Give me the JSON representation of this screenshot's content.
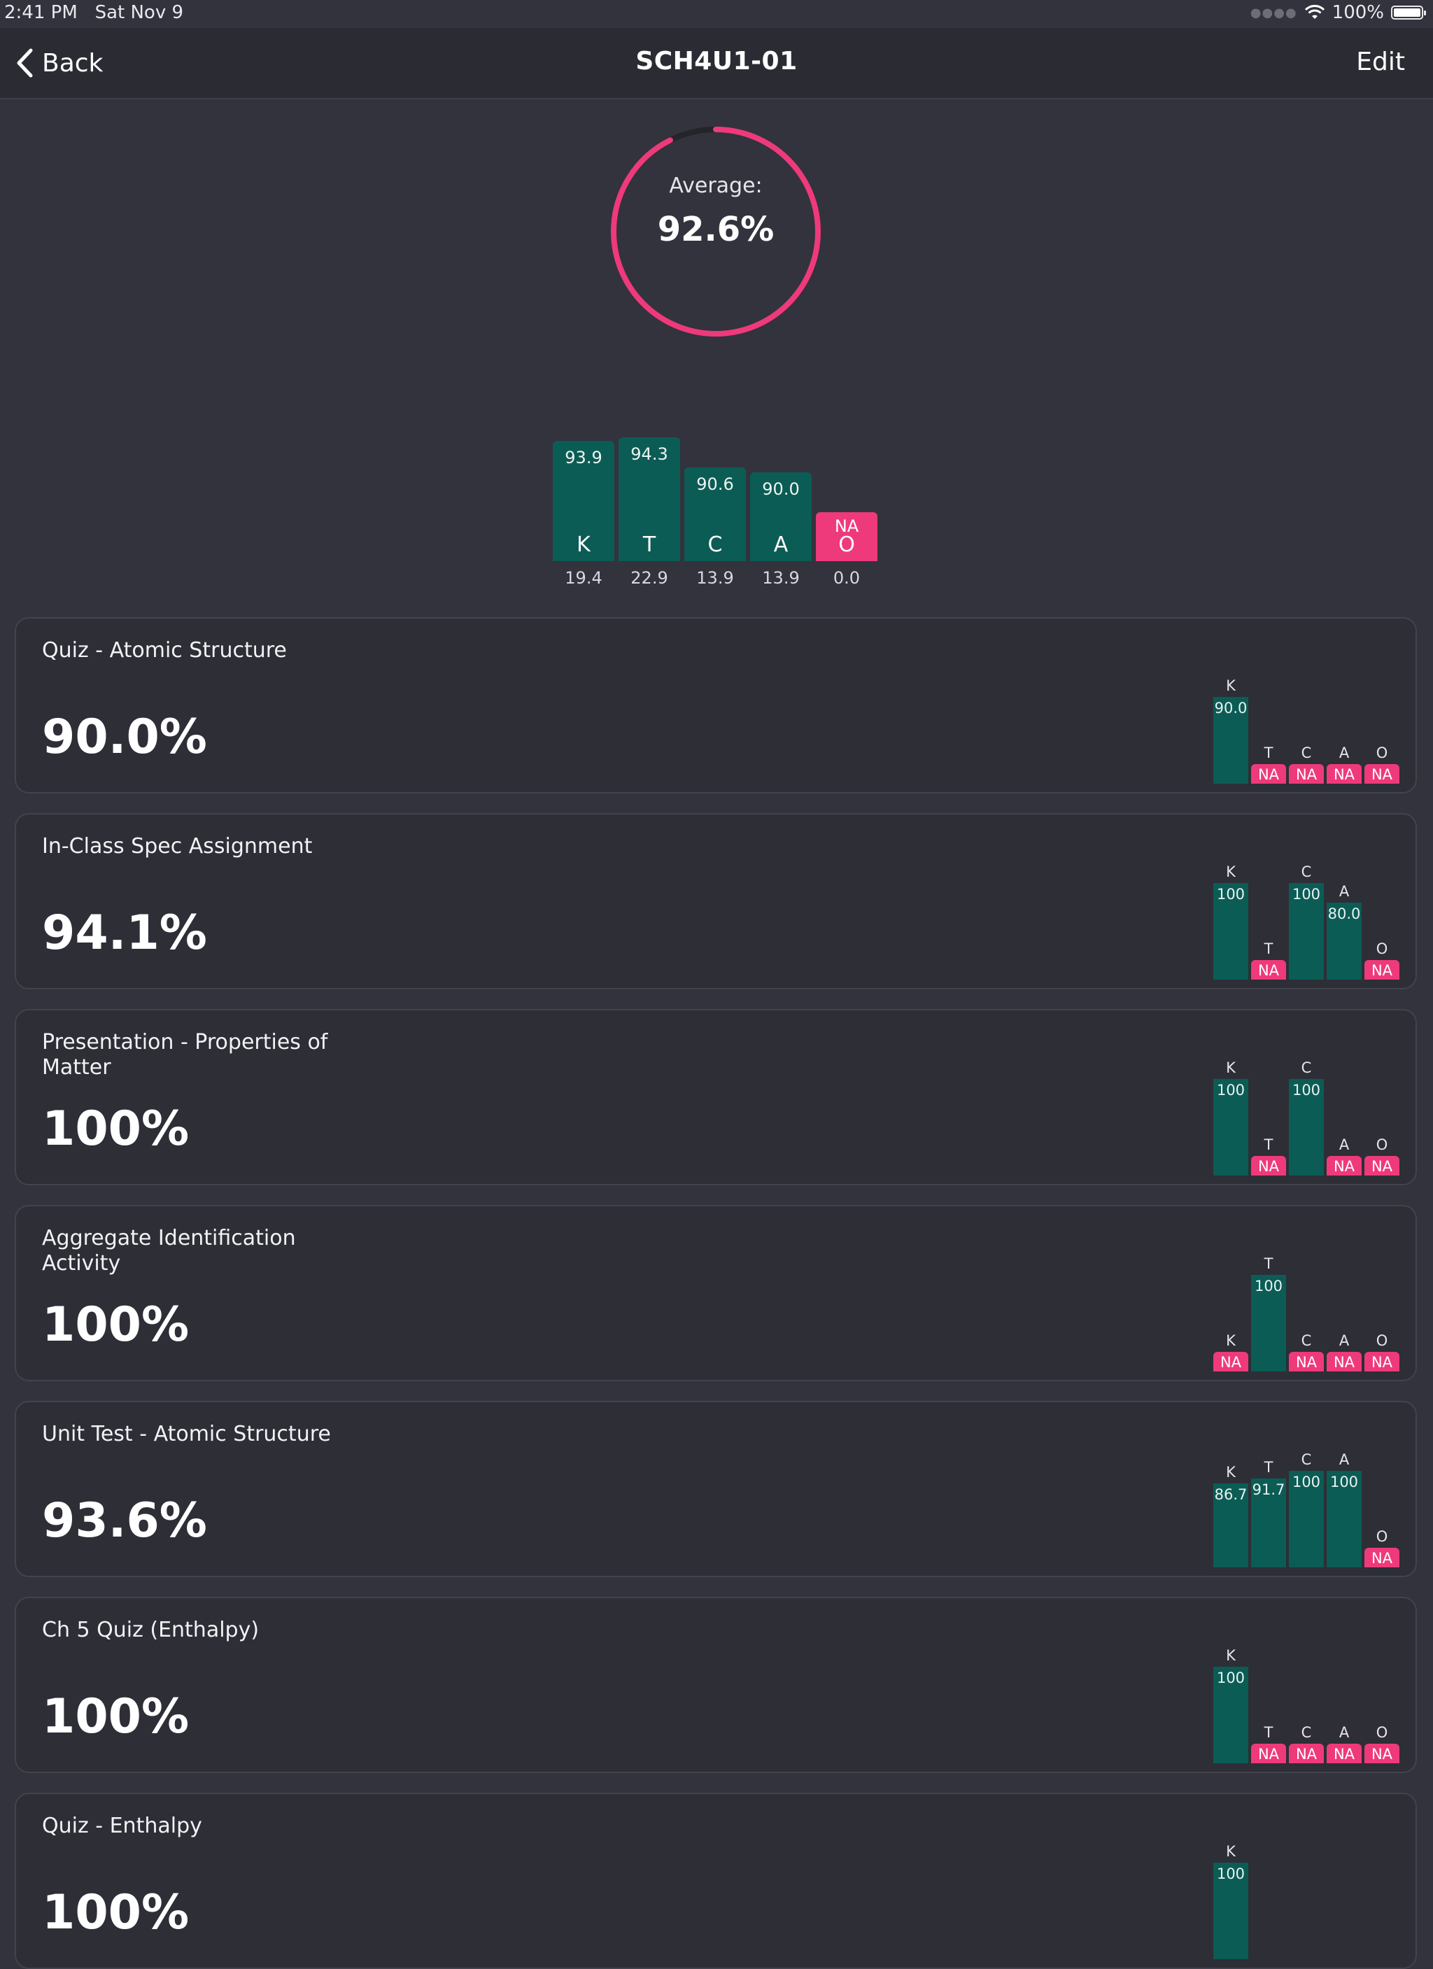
{
  "status_bar": {
    "time": "2:41 PM",
    "date": "Sat Nov 9",
    "battery": "100%"
  },
  "nav": {
    "back_label": "Back",
    "title": "SCH4U1-01",
    "edit_label": "Edit"
  },
  "average": {
    "label": "Average:",
    "value": "92.6%",
    "fraction": 0.926
  },
  "summary": [
    {
      "cat": "K",
      "score": "93.9",
      "weight": "19.4",
      "na": false
    },
    {
      "cat": "T",
      "score": "94.3",
      "weight": "22.9",
      "na": false
    },
    {
      "cat": "C",
      "score": "90.6",
      "weight": "13.9",
      "na": false
    },
    {
      "cat": "A",
      "score": "90.0",
      "weight": "13.9",
      "na": false
    },
    {
      "cat": "O",
      "score": "NA",
      "weight": "0.0",
      "na": true
    }
  ],
  "assessments": [
    {
      "title": "Quiz - Atomic Structure",
      "percent": "90.0%",
      "cats": [
        {
          "c": "K",
          "v": "90.0"
        },
        {
          "c": "T",
          "v": "NA"
        },
        {
          "c": "C",
          "v": "NA"
        },
        {
          "c": "A",
          "v": "NA"
        },
        {
          "c": "O",
          "v": "NA"
        }
      ]
    },
    {
      "title": "In-Class Spec Assignment",
      "percent": "94.1%",
      "cats": [
        {
          "c": "K",
          "v": "100"
        },
        {
          "c": "T",
          "v": "NA"
        },
        {
          "c": "C",
          "v": "100"
        },
        {
          "c": "A",
          "v": "80.0"
        },
        {
          "c": "O",
          "v": "NA"
        }
      ]
    },
    {
      "title": "Presentation - Properties of Matter",
      "percent": "100%",
      "cats": [
        {
          "c": "K",
          "v": "100"
        },
        {
          "c": "T",
          "v": "NA"
        },
        {
          "c": "C",
          "v": "100"
        },
        {
          "c": "A",
          "v": "NA"
        },
        {
          "c": "O",
          "v": "NA"
        }
      ]
    },
    {
      "title": "Aggregate Identification Activity",
      "percent": "100%",
      "cats": [
        {
          "c": "K",
          "v": "NA"
        },
        {
          "c": "T",
          "v": "100"
        },
        {
          "c": "C",
          "v": "NA"
        },
        {
          "c": "A",
          "v": "NA"
        },
        {
          "c": "O",
          "v": "NA"
        }
      ]
    },
    {
      "title": "Unit Test - Atomic Structure",
      "percent": "93.6%",
      "cats": [
        {
          "c": "K",
          "v": "86.7"
        },
        {
          "c": "T",
          "v": "91.7"
        },
        {
          "c": "C",
          "v": "100"
        },
        {
          "c": "A",
          "v": "100"
        },
        {
          "c": "O",
          "v": "NA"
        }
      ]
    },
    {
      "title": "Ch 5 Quiz (Enthalpy)",
      "percent": "100%",
      "cats": [
        {
          "c": "K",
          "v": "100"
        },
        {
          "c": "T",
          "v": "NA"
        },
        {
          "c": "C",
          "v": "NA"
        },
        {
          "c": "A",
          "v": "NA"
        },
        {
          "c": "O",
          "v": "NA"
        }
      ]
    },
    {
      "title": "Quiz - Enthalpy",
      "percent": "100%",
      "cats": [
        {
          "c": "K",
          "v": "100"
        }
      ]
    }
  ],
  "colors": {
    "bar": "#0b5c55",
    "na": "#ee3a7a",
    "ring": "#ee3a7a",
    "background": "#32333c",
    "card": "#2d2e36"
  }
}
